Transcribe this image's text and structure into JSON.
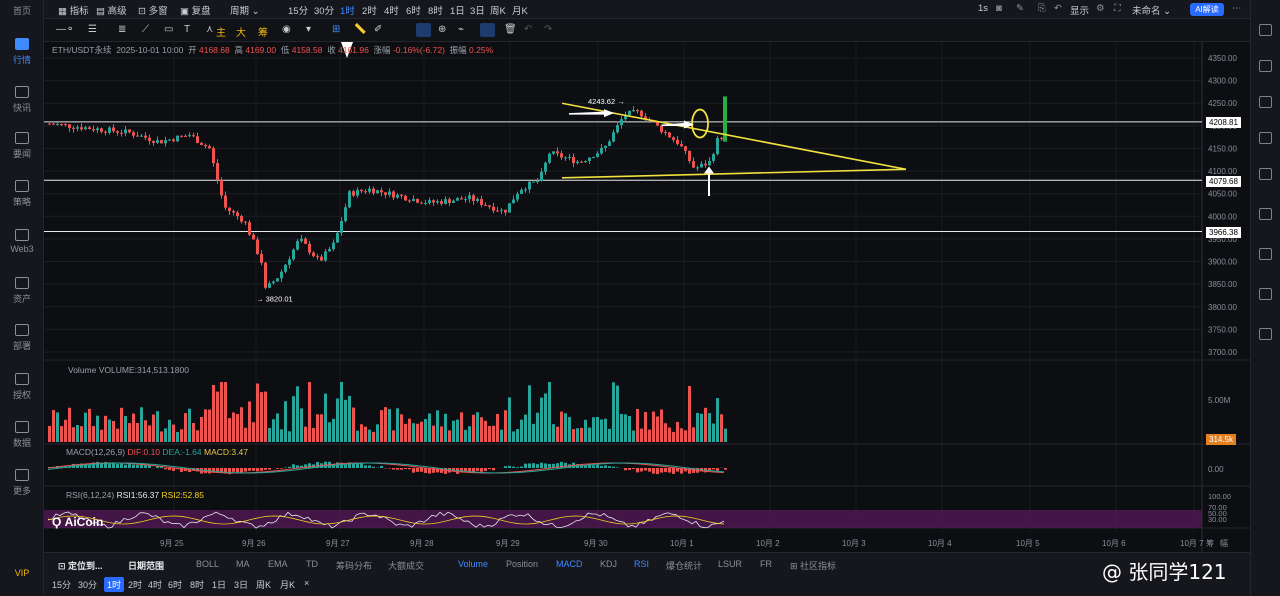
{
  "sidebar": {
    "items": [
      {
        "label": "首页",
        "icon": "home-icon"
      },
      {
        "label": "行情",
        "icon": "chart-bar-icon",
        "active": true
      },
      {
        "label": "快讯",
        "icon": "news-icon"
      },
      {
        "label": "要闻",
        "icon": "article-icon"
      },
      {
        "label": "策略",
        "icon": "robot-icon"
      },
      {
        "label": "Web3",
        "icon": "web3-icon"
      },
      {
        "label": "资产",
        "icon": "wallet-icon"
      },
      {
        "label": "部署",
        "icon": "deploy-icon"
      },
      {
        "label": "授权",
        "icon": "key-icon"
      },
      {
        "label": "数据",
        "icon": "data-icon"
      },
      {
        "label": "更多",
        "icon": "more-icon"
      }
    ],
    "vip": "VIP"
  },
  "topbar": {
    "indicators": "指标",
    "advanced": "高级",
    "multi_window": "多窗",
    "replay": "复盘",
    "period": "周期",
    "periods": [
      "15分",
      "30分",
      "1时",
      "2时",
      "4时",
      "6时",
      "8时",
      "1日",
      "3日",
      "周K",
      "月K"
    ],
    "active_period": "1时",
    "refresh": "1s",
    "display": "显示",
    "unnamed": "未命名",
    "ai": "AI解读"
  },
  "drawbar": {
    "main": "主",
    "big": "大",
    "chips": "筹"
  },
  "chart": {
    "legend": {
      "symbol": "ETH/USDT永续",
      "time": "2025-10-01 10:00",
      "open_label": "开",
      "open": "4168.68",
      "high_label": "高",
      "high": "4169.00",
      "low_label": "低",
      "low": "4158.58",
      "close_label": "收",
      "close": "4161.96",
      "change_label": "涨幅",
      "change": "-0.16%(-6.72)",
      "amp_label": "振幅",
      "amp": "0.25%"
    },
    "price_axis": [
      "4350.00",
      "4300.00",
      "4250.00",
      "4200.00",
      "4150.00",
      "4100.00",
      "4050.00",
      "4000.00",
      "3950.00",
      "3900.00",
      "3850.00",
      "3800.00",
      "3750.00",
      "3700.00"
    ],
    "hlines": [
      "4208.81",
      "4079.68",
      "3966.38"
    ],
    "annotations": {
      "high": "4243.62 →",
      "low": "→ 3820.01"
    },
    "volume_legend": "Volume  VOLUME:314,513.1800",
    "volume_axis": "5.00M",
    "volume_tag": "314.5k",
    "macd_legend": {
      "name": "MACD(12,26,9)",
      "dif": "DIF:0.10",
      "dea": "DEA:-1.64",
      "macd": "MACD:3.47"
    },
    "macd_axis": "0.00",
    "rsi_legend": {
      "name": "RSI(6,12,24)",
      "rsi1": "RSI1:56.37",
      "rsi2": "RSI2:52.85"
    },
    "rsi_axis": [
      "100.00",
      "70.00",
      "50.00",
      "30.00"
    ],
    "logo": "AiCoin",
    "dates": [
      "9月 25",
      "9月 26",
      "9月 27",
      "9月 28",
      "9月 29",
      "9月 30",
      "10月 1",
      "10月 2",
      "10月 3",
      "10月 4",
      "10月 5",
      "10月 6",
      "10月 7"
    ],
    "date_extra": "筹",
    "date_extra2": "幅"
  },
  "bottomtabs": {
    "locate": "定位到...",
    "date_range": "日期范围",
    "indicators": [
      "BOLL",
      "MA",
      "EMA",
      "TD",
      "筹码分布",
      "大额成交",
      "Volume",
      "Position",
      "MACD",
      "KDJ",
      "RSI",
      "爆仓统计",
      "LSUR",
      "FR",
      "社区指标"
    ]
  },
  "periodbar": {
    "periods": [
      "15分",
      "30分",
      "1时",
      "2时",
      "4时",
      "6时",
      "8时",
      "1日",
      "3日",
      "周K",
      "月K"
    ],
    "close": "×"
  },
  "watermark": "@ 张同学121",
  "colors": {
    "up": "#26a69a",
    "down": "#ef5350",
    "accent": "#3d8bff",
    "trend": "#f0e040",
    "rsi_band": "#5b1a5e"
  }
}
